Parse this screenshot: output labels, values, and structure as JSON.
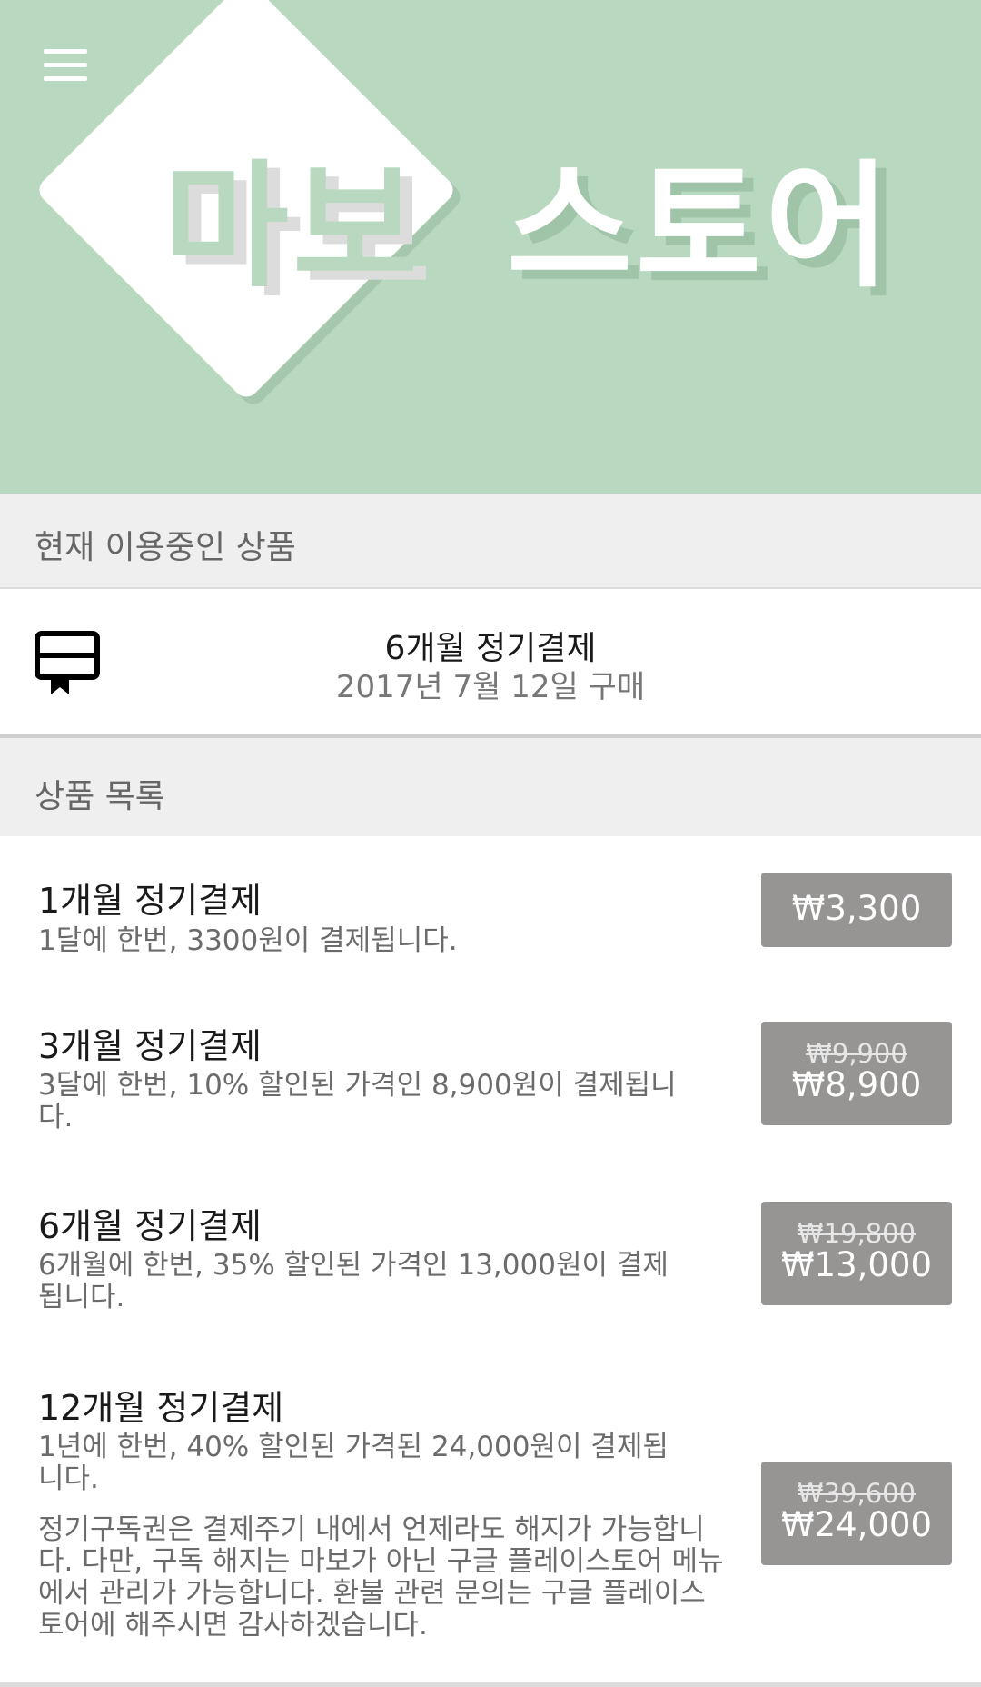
{
  "header": {
    "logo_part1": "마보",
    "logo_part2": "스토어"
  },
  "current_section": {
    "heading": "현재 이용중인 상품",
    "product_title": "6개월 정기결제",
    "purchase_date": "2017년 7월 12일 구매"
  },
  "list_section": {
    "heading": "상품 목록"
  },
  "products": [
    {
      "title": "1개월 정기결제",
      "desc": "1달에 한번, 3300원이 결제됩니다.",
      "old_price": "",
      "price": "₩3,300"
    },
    {
      "title": "3개월 정기결제",
      "desc": "3달에 한번, 10% 할인된 가격인 8,900원이 결제됩니다.",
      "old_price": "₩9,900",
      "price": "₩8,900"
    },
    {
      "title": "6개월 정기결제",
      "desc": "6개월에 한번, 35% 할인된 가격인 13,000원이 결제됩니다.",
      "old_price": "₩19,800",
      "price": "₩13,000"
    },
    {
      "title": "12개월 정기결제",
      "desc": "1년에 한번, 40% 할인된 가격된 24,000원이 결제됩니다.",
      "old_price": "₩39,600",
      "price": "₩24,000",
      "note": "정기구독권은 결제주기 내에서 언제라도 해지가 가능합니다.  다만, 구독 해지는 마보가 아닌 구글 플레이스토어 메뉴에서 관리가 가능합니다.  환불 관련 문의는 구글 플레이스토어에 해주시면 감사하겠습니다."
    }
  ],
  "colors": {
    "banner": "#b8d9c0",
    "section_bg": "#efefef",
    "price_button": "#969594"
  },
  "icons": {
    "menu": "hamburger-menu-icon",
    "ticket": "ticket-icon"
  }
}
